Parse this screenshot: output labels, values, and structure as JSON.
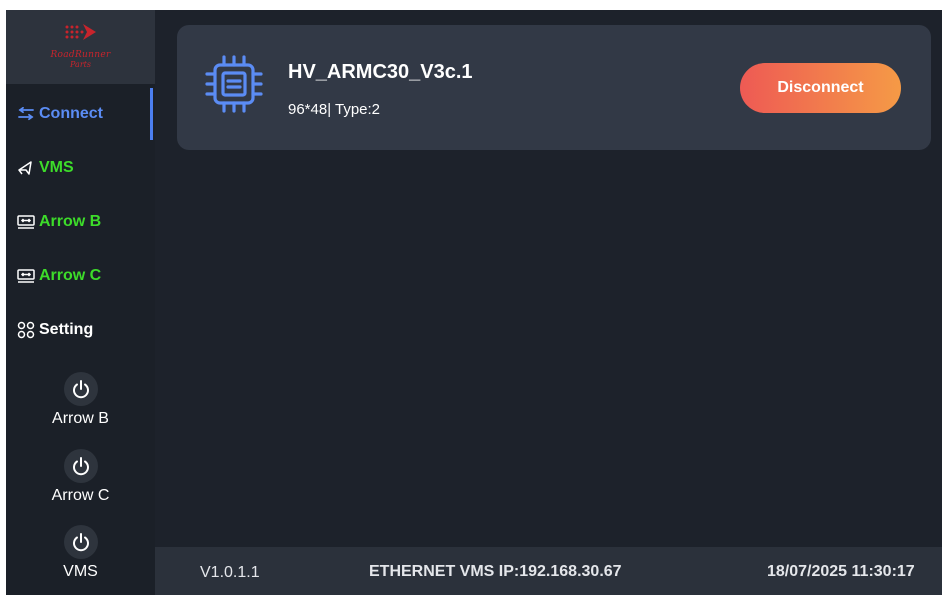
{
  "logo": {
    "line1": "RoadRunner",
    "line2": "Parts"
  },
  "sidebar": {
    "items": [
      {
        "label": "Connect",
        "icon": "connect-icon",
        "color": "#5b8cf4"
      },
      {
        "label": "VMS",
        "icon": "megaphone-icon",
        "color": "#3ddc2a"
      },
      {
        "label": "Arrow B",
        "icon": "display-icon",
        "color": "#3ddc2a"
      },
      {
        "label": "Arrow C",
        "icon": "display-icon",
        "color": "#3ddc2a"
      },
      {
        "label": "Setting",
        "icon": "grid-icon",
        "color": "#ffffff"
      }
    ],
    "power": [
      {
        "label": "Arrow B",
        "icon": "power-icon"
      },
      {
        "label": "Arrow C",
        "icon": "power-icon"
      },
      {
        "label": "VMS",
        "icon": "power-icon"
      }
    ]
  },
  "device": {
    "icon": "chip-icon",
    "name": "HV_ARMC30_V3c.1",
    "sub": "96*48| Type:2",
    "button": "Disconnect"
  },
  "status": {
    "version": "V1.0.1.1",
    "ip": "ETHERNET VMS IP:192.168.30.67",
    "datetime": "18/07/2025 11:30:17"
  },
  "colors": {
    "background": "#1d222b",
    "card": "#323946",
    "accent": "#5b8cf4",
    "green": "#3ddc2a",
    "button_start": "#ee5a54",
    "button_end": "#f59a46"
  }
}
